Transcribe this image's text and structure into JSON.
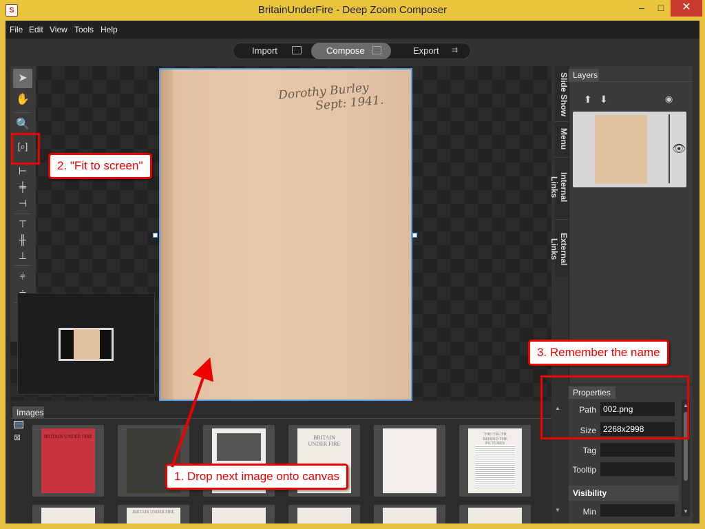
{
  "window": {
    "title": "BritainUnderFire - Deep Zoom Composer",
    "icon": "app-logo-icon",
    "minimize": "–",
    "maximize": "□",
    "close": "✕"
  },
  "menu": [
    "File",
    "Edit",
    "View",
    "Tools",
    "Help"
  ],
  "modes": [
    {
      "label": "Import",
      "icon": "import-icon"
    },
    {
      "label": "Compose",
      "icon": "compose-icon"
    },
    {
      "label": "Export",
      "icon": "export-icon"
    }
  ],
  "toolbar": {
    "tools": [
      "select-arrow-icon",
      "pan-hand-icon",
      "zoom-icon",
      "fit-to-screen-icon",
      "align-left-icon",
      "align-center-icon",
      "align-right-icon",
      "align-top-icon",
      "align-middle-icon",
      "align-bottom-icon",
      "distribute-horizontal-icon",
      "distribute-vertical-icon",
      "same-width-icon",
      "same-height-icon"
    ]
  },
  "canvas": {
    "signature_line1": "Dorothy Burley",
    "signature_line2": "Sept: 1941."
  },
  "side_tabs": [
    "Slide Show",
    "Menu",
    "Internal Links",
    "External Links"
  ],
  "layers": {
    "title": "Layers",
    "controls": [
      "move-up-icon",
      "move-down-icon",
      "visibility-icon"
    ]
  },
  "images": {
    "title": "Images",
    "thumbnails": [
      {
        "kind": "red cover",
        "text": "BRITAIN UNDER FIRE"
      },
      {
        "kind": "dark cover",
        "text": ""
      },
      {
        "kind": "photo page",
        "text": ""
      },
      {
        "kind": "title page",
        "text": "BRITAIN UNDER FIRE"
      },
      {
        "kind": "blank page",
        "text": ""
      },
      {
        "kind": "text page",
        "text": "THE TRUTH BEHIND THE PICTURES"
      }
    ],
    "row2_text": "BRITAIN UNDER FIRE"
  },
  "properties": {
    "title": "Properties",
    "path_label": "Path",
    "path_value": "002.png",
    "size_label": "Size",
    "size_value": "2268x2998",
    "tag_label": "Tag",
    "tooltip_label": "Tooltip",
    "visibility_label": "Visibility",
    "min_label": "Min"
  },
  "annotations": {
    "step1": "1. Drop next image onto canvas",
    "step2": "2. \"Fit to screen\"",
    "step3": "3. Remember the name"
  },
  "colors": {
    "accent_highlight": "#e00000",
    "selection_border": "#5aa0e6",
    "titlebar": "#e9c53e"
  }
}
